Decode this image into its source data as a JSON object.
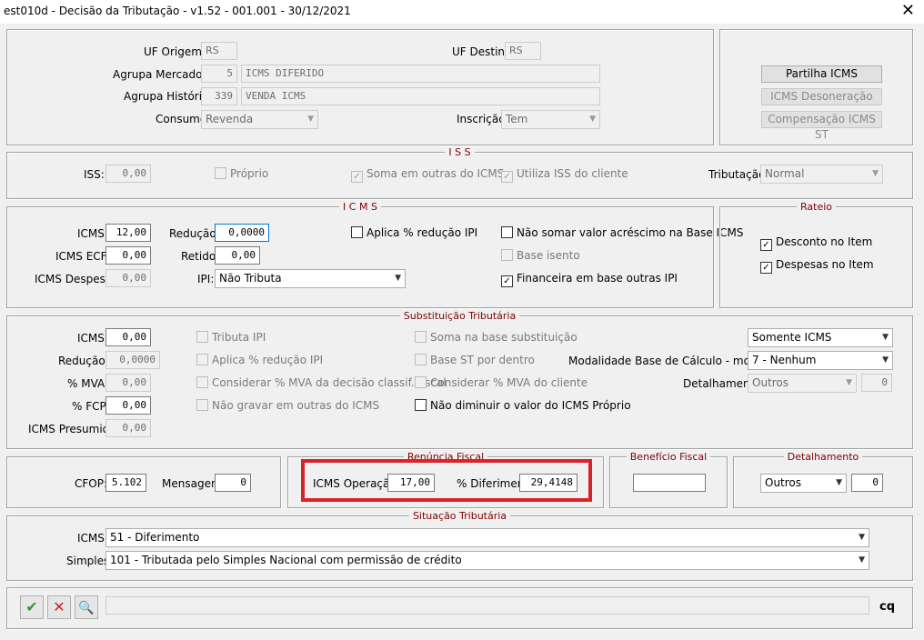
{
  "window": {
    "title": "est010d - Decisão da Tributação - v1.52 - 001.001 - 30/12/2021",
    "close_label": "✕"
  },
  "header": {
    "uf_origem_label": "UF Origem:",
    "uf_origem_value": "RS",
    "uf_destino_label": "UF Destino:",
    "uf_destino_value": "RS",
    "agrupa_mercadoria_label": "Agrupa Mercadoria:",
    "agrupa_mercadoria_code": "5",
    "agrupa_mercadoria_desc": "ICMS DIFERIDO",
    "agrupa_historico_label": "Agrupa Histórico:",
    "agrupa_historico_code": "339",
    "agrupa_historico_desc": "VENDA ICMS",
    "consumo_label": "Consumo:",
    "consumo_value": "Revenda",
    "inscricao_label": "Inscrição:",
    "inscricao_value": "Tem"
  },
  "side_buttons": {
    "partilha": "Partilha ICMS",
    "desoneracao": "ICMS Desoneração",
    "compensacao": "Compensação ICMS ST"
  },
  "iss": {
    "title": "I S S",
    "iss_label": "ISS:",
    "iss_value": "0,00",
    "proprio": "Próprio",
    "soma_outras": "Soma em outras do ICMS",
    "utiliza_cliente": "Utiliza ISS do cliente",
    "tributacao_label": "Tributação:",
    "tributacao_value": "Normal"
  },
  "icms": {
    "title": "I C M S",
    "icms_label": "ICMS:",
    "icms_value": "12,00",
    "reducao_label": "Redução:",
    "reducao_value": "0,0000",
    "icms_ecf_label": "ICMS ECF:",
    "icms_ecf_value": "0,00",
    "retido_label": "Retido:",
    "retido_value": "0,00",
    "icms_despesa_label": "ICMS Despesa:",
    "icms_despesa_value": "0,00",
    "ipi_label": "IPI:",
    "ipi_value": "Não Tributa",
    "aplica_reducao_ipi": "Aplica % redução IPI",
    "nao_somar": "Não somar valor acréscimo na Base ICMS",
    "base_isento": "Base isento",
    "financeira": "Financeira em base outras IPI"
  },
  "rateio": {
    "title": "Rateio",
    "desconto": "Desconto no Item",
    "despesas": "Despesas no Item"
  },
  "st": {
    "title": "Substituição Tributária",
    "icms_label": "ICMS:",
    "icms_value": "0,00",
    "reducao_label": "Redução:",
    "reducao_value": "0,0000",
    "mva_label": "% MVA:",
    "mva_value": "0,00",
    "fcp_label": "% FCP:",
    "fcp_value": "0,00",
    "icms_presumido_label": "ICMS Presumido:",
    "icms_presumido_value": "0,00",
    "tributa_ipi": "Tributa IPI",
    "aplica_reducao_ipi": "Aplica % redução IPI",
    "considerar_mva_decisao": "Considerar % MVA da decisão classif. fiscal",
    "nao_gravar": "Não gravar em outras do ICMS",
    "soma_base_subst": "Soma na base substituição",
    "base_st_dentro": "Base ST por dentro",
    "considerar_mva_cliente": "Considerar % MVA do cliente",
    "nao_diminuir": "Não diminuir o valor do ICMS Próprio",
    "somente_icms": "Somente ICMS",
    "modalidade_label": "Modalidade Base de Cálculo - modBCST:",
    "modalidade_value": "7 - Nenhum",
    "detalhamento_label": "Detalhamento:",
    "detalhamento_value": "Outros",
    "detalhamento_num": "0"
  },
  "cfop": {
    "cfop_label": "CFOP:",
    "cfop_value": "5.102",
    "mensagem_label": "Mensagem:",
    "mensagem_value": "0"
  },
  "renuncia": {
    "title": "Renúncia Fiscal",
    "icms_operacao_label": "ICMS Operação:",
    "icms_operacao_value": "17,00",
    "diferimento_label": "% Diferimento:",
    "diferimento_value": "29,4148"
  },
  "beneficio": {
    "title": "Benefício Fiscal",
    "value": ""
  },
  "detalhamento": {
    "title": "Detalhamento",
    "value": "Outros",
    "num": "0"
  },
  "situacao": {
    "title": "Situação Tributária",
    "icms_label": "ICMS:",
    "icms_value": "51 - Diferimento",
    "simples_label": "Simples:",
    "simples_value": "101 - Tributada pelo Simples Nacional com permissão de crédito"
  },
  "footer": {
    "logo": "cq"
  },
  "colors": {
    "highlight": "#d8232a",
    "group_title": "#800000",
    "focus": "#0078d7"
  }
}
